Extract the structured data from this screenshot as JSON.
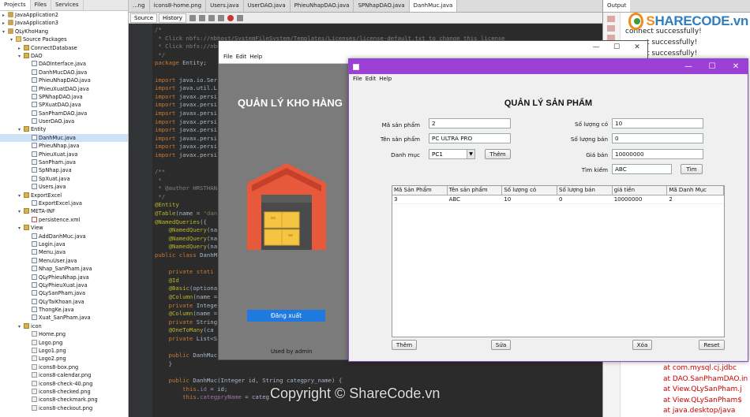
{
  "left_panel": {
    "tabs": [
      "Projects",
      "Files",
      "Services"
    ],
    "tree": [
      {
        "label": "JavaApplication2",
        "level": 0,
        "icon": "project-icon",
        "toggle": "+"
      },
      {
        "label": "JavaApplication3",
        "level": 0,
        "icon": "project-icon",
        "toggle": "+"
      },
      {
        "label": "QLyKhoHang",
        "level": 0,
        "icon": "project-icon",
        "toggle": "-"
      },
      {
        "label": "Source Packages",
        "level": 1,
        "icon": "folder-icon",
        "toggle": "-"
      },
      {
        "label": "ConnectDatabase",
        "level": 2,
        "icon": "package-icon",
        "toggle": "+"
      },
      {
        "label": "DAO",
        "level": 2,
        "icon": "package-icon",
        "toggle": "-"
      },
      {
        "label": "DAOInterface.java",
        "level": 3,
        "icon": "java-file-icon"
      },
      {
        "label": "DanhMucDAO.java",
        "level": 3,
        "icon": "java-file-icon"
      },
      {
        "label": "PhieuNhapDAO.java",
        "level": 3,
        "icon": "java-file-icon"
      },
      {
        "label": "PhieuXuatDAO.java",
        "level": 3,
        "icon": "java-file-icon"
      },
      {
        "label": "SPNhapDAO.java",
        "level": 3,
        "icon": "java-file-icon"
      },
      {
        "label": "SPXuatDAO.java",
        "level": 3,
        "icon": "java-file-icon"
      },
      {
        "label": "SanPhamDAO.java",
        "level": 3,
        "icon": "java-file-icon"
      },
      {
        "label": "UserDAO.java",
        "level": 3,
        "icon": "java-file-icon"
      },
      {
        "label": "Entity",
        "level": 2,
        "icon": "package-icon",
        "toggle": "-"
      },
      {
        "label": "DanhMuc.java",
        "level": 3,
        "icon": "java-file-icon",
        "selected": true
      },
      {
        "label": "PhieuNhap.java",
        "level": 3,
        "icon": "java-file-icon"
      },
      {
        "label": "PhieuXuat.java",
        "level": 3,
        "icon": "java-file-icon"
      },
      {
        "label": "SanPham.java",
        "level": 3,
        "icon": "java-file-icon"
      },
      {
        "label": "SpNhap.java",
        "level": 3,
        "icon": "java-file-icon"
      },
      {
        "label": "SpXuat.java",
        "level": 3,
        "icon": "java-file-icon"
      },
      {
        "label": "Users.java",
        "level": 3,
        "icon": "java-file-icon"
      },
      {
        "label": "ExportExcel",
        "level": 2,
        "icon": "package-icon",
        "toggle": "-"
      },
      {
        "label": "ExportExcel.java",
        "level": 3,
        "icon": "java-file-icon"
      },
      {
        "label": "META-INF",
        "level": 2,
        "icon": "package-icon",
        "toggle": "-"
      },
      {
        "label": "persistence.xml",
        "level": 3,
        "icon": "xml-file-icon"
      },
      {
        "label": "View",
        "level": 2,
        "icon": "package-icon",
        "toggle": "-"
      },
      {
        "label": "AddDanhMuc.java",
        "level": 3,
        "icon": "java-file-icon"
      },
      {
        "label": "Login.java",
        "level": 3,
        "icon": "java-file-icon"
      },
      {
        "label": "Menu.java",
        "level": 3,
        "icon": "java-file-icon"
      },
      {
        "label": "MenuUser.java",
        "level": 3,
        "icon": "java-file-icon"
      },
      {
        "label": "Nhap_SanPham.java",
        "level": 3,
        "icon": "java-file-icon"
      },
      {
        "label": "QLyPhieuNhap.java",
        "level": 3,
        "icon": "java-file-icon"
      },
      {
        "label": "QLyPhieuXuat.java",
        "level": 3,
        "icon": "java-file-icon"
      },
      {
        "label": "QLySanPham.java",
        "level": 3,
        "icon": "java-file-icon"
      },
      {
        "label": "QLyTaiKhoan.java",
        "level": 3,
        "icon": "java-file-icon"
      },
      {
        "label": "ThongKe.java",
        "level": 3,
        "icon": "java-file-icon"
      },
      {
        "label": "Xuat_SanPham.java",
        "level": 3,
        "icon": "java-file-icon"
      },
      {
        "label": "icon",
        "level": 2,
        "icon": "package-icon",
        "toggle": "-"
      },
      {
        "label": "Home.png",
        "level": 3,
        "icon": "image-file-icon"
      },
      {
        "label": "Logo.png",
        "level": 3,
        "icon": "image-file-icon"
      },
      {
        "label": "Logo1.png",
        "level": 3,
        "icon": "image-file-icon"
      },
      {
        "label": "Logo2.png",
        "level": 3,
        "icon": "image-file-icon"
      },
      {
        "label": "icons8-box.png",
        "level": 3,
        "icon": "image-file-icon"
      },
      {
        "label": "icons8-calendar.png",
        "level": 3,
        "icon": "image-file-icon"
      },
      {
        "label": "icons8-check-40.png",
        "level": 3,
        "icon": "image-file-icon"
      },
      {
        "label": "icons8-checked.png",
        "level": 3,
        "icon": "image-file-icon"
      },
      {
        "label": "icons8-checkmark.png",
        "level": 3,
        "icon": "image-file-icon"
      },
      {
        "label": "icons8-checkout.png",
        "level": 3,
        "icon": "image-file-icon"
      }
    ]
  },
  "editor": {
    "tabs": [
      "...ng",
      "icons8-home.png",
      "Users.java",
      "UserDAO.java",
      "PhieuNhapDAO.java",
      "SPNhapDAO.java",
      "DanhMuc.java"
    ],
    "active_tab": "DanhMuc.java",
    "toolbar": {
      "source": "Source",
      "history": "History"
    },
    "lines": [
      [
        [
          "cm",
          "/*"
        ]
      ],
      [
        [
          "cm",
          " * Click nbfs://nbhost/SystemFileSystem/Templates/Licenses/license-default.txt to change this license"
        ]
      ],
      [
        [
          "cm",
          " * Click nbfs://nbhost"
        ]
      ],
      [
        [
          "cm",
          " */"
        ]
      ],
      [
        [
          "kw",
          "package"
        ],
        [
          "",
          " Entity;"
        ]
      ],
      [
        [
          "",
          ""
        ]
      ],
      [
        [
          "kw",
          "import"
        ],
        [
          "",
          " java.io.Ser"
        ]
      ],
      [
        [
          "kw",
          "import"
        ],
        [
          "",
          " java.util.L"
        ]
      ],
      [
        [
          "kw",
          "import"
        ],
        [
          "",
          " javax.persi"
        ]
      ],
      [
        [
          "kw",
          "import"
        ],
        [
          "",
          " javax.persi"
        ]
      ],
      [
        [
          "kw",
          "import"
        ],
        [
          "",
          " javax.persi"
        ]
      ],
      [
        [
          "kw",
          "import"
        ],
        [
          "",
          " javax.persi"
        ]
      ],
      [
        [
          "kw",
          "import"
        ],
        [
          "",
          " javax.persi"
        ]
      ],
      [
        [
          "kw",
          "import"
        ],
        [
          "",
          " javax.persi"
        ]
      ],
      [
        [
          "kw",
          "import"
        ],
        [
          "",
          " javax.persi"
        ]
      ],
      [
        [
          "kw",
          "import"
        ],
        [
          "",
          " javax.persi"
        ]
      ],
      [
        [
          "",
          ""
        ]
      ],
      [
        [
          "cm",
          "/**"
        ]
      ],
      [
        [
          "cm",
          " *"
        ]
      ],
      [
        [
          "cm",
          " * @author HRSTHAN"
        ]
      ],
      [
        [
          "cm",
          " */"
        ]
      ],
      [
        [
          "an",
          "@Entity"
        ]
      ],
      [
        [
          "an",
          "@Table"
        ],
        [
          "",
          "(name = "
        ],
        [
          "str",
          "\"dan"
        ]
      ],
      [
        [
          "an",
          "@NamedQueries"
        ],
        [
          "",
          "({"
        ]
      ],
      [
        [
          "",
          "    "
        ],
        [
          "an",
          "@NamedQuery"
        ],
        [
          "",
          "(na"
        ]
      ],
      [
        [
          "",
          "    "
        ],
        [
          "an",
          "@NamedQuery"
        ],
        [
          "",
          "(na"
        ]
      ],
      [
        [
          "",
          "    "
        ],
        [
          "an",
          "@NamedQuery"
        ],
        [
          "",
          "(na"
        ]
      ],
      [
        [
          "kw",
          "public class"
        ],
        [
          "",
          " DanhM"
        ]
      ],
      [
        [
          "",
          ""
        ]
      ],
      [
        [
          "",
          "    "
        ],
        [
          "kw",
          "private stati"
        ]
      ],
      [
        [
          "",
          "    "
        ],
        [
          "an",
          "@Id"
        ]
      ],
      [
        [
          "",
          "    "
        ],
        [
          "an",
          "@Basic"
        ],
        [
          "",
          "(optiona"
        ]
      ],
      [
        [
          "",
          "    "
        ],
        [
          "an",
          "@Column"
        ],
        [
          "",
          "(name ="
        ]
      ],
      [
        [
          "",
          "    "
        ],
        [
          "kw",
          "private"
        ],
        [
          "",
          " Intege"
        ]
      ],
      [
        [
          "",
          "    "
        ],
        [
          "an",
          "@Column"
        ],
        [
          "",
          "(name ="
        ]
      ],
      [
        [
          "",
          "    "
        ],
        [
          "kw",
          "private"
        ],
        [
          "",
          " String"
        ]
      ],
      [
        [
          "",
          "    "
        ],
        [
          "an",
          "@OneToMany"
        ],
        [
          "",
          "(ca"
        ]
      ],
      [
        [
          "",
          "    "
        ],
        [
          "kw",
          "private"
        ],
        [
          "",
          " List<S"
        ]
      ],
      [
        [
          "",
          ""
        ]
      ],
      [
        [
          "",
          "    "
        ],
        [
          "kw",
          "public"
        ],
        [
          "",
          " DanhMuc"
        ]
      ],
      [
        [
          "",
          "    }"
        ]
      ],
      [
        [
          "",
          ""
        ]
      ],
      [
        [
          "",
          "    "
        ],
        [
          "kw",
          "public"
        ],
        [
          "",
          " DanhMuc(Integer id, String categpry_name) {"
        ]
      ],
      [
        [
          "",
          "        "
        ],
        [
          "kw",
          "this"
        ],
        [
          "",
          "."
        ],
        [
          "fld",
          "id"
        ],
        [
          "",
          " = id;"
        ]
      ],
      [
        [
          "",
          "        "
        ],
        [
          "kw",
          "this"
        ],
        [
          "",
          "."
        ],
        [
          "fld",
          "categpryName"
        ],
        [
          "",
          " = categ"
        ]
      ]
    ]
  },
  "output": {
    "tab": "Output",
    "lines": [
      {
        "text": "connect successfully!",
        "error": false
      },
      {
        "text": "ct successfully!",
        "error": false
      },
      {
        "text": "ct successfully!",
        "error": false
      }
    ],
    "error_lines": [
      "at com.mysql.cj.jdbc",
      "at DAO.SanPhamDAO.in",
      "at View.QLySanPham.j",
      "at View.QLySanPham$",
      "at java.desktop/java"
    ]
  },
  "watermark": {
    "logo": "SHARECODE.vn",
    "copyright": "Copyright © ShareCode.vn",
    "center": "ShareCode.vn"
  },
  "menu_window": {
    "menu": [
      "File",
      "Edit",
      "Help"
    ],
    "heading": "QUẢN LÝ KHO HÀNG",
    "logout_button": "Đăng xuất",
    "used_by": "Used by  admin"
  },
  "product_window": {
    "menu": [
      "File",
      "Edit",
      "Help"
    ],
    "title": "QUẢN LÝ SẢN PHẨM",
    "fields": {
      "ma_label": "Mã sản phẩm",
      "ma_value": "2",
      "ten_label": "Tên sản phẩm",
      "ten_value": "PC ULTRA PRO",
      "danhmuc_label": "Danh mục",
      "danhmuc_value": "PC1",
      "soluongco_label": "Số lượng có",
      "soluongco_value": "10",
      "soluongban_label": "Số lượng bán",
      "soluongban_value": "0",
      "giaban_label": "Giá bán",
      "giaban_value": "10000000",
      "timkiem_label": "Tìm kiếm",
      "timkiem_value": "ABC"
    },
    "add_category_button": "Thêm",
    "search_button": "Tìm",
    "table": {
      "headers": [
        "Mã Sản Phẩm",
        "Tên sản phẩm",
        "Số lượng có",
        "Số lượng bán",
        "giá tiền",
        "Mã Danh Mục"
      ],
      "rows": [
        [
          "3",
          "ABC",
          "10",
          "0",
          "10000000",
          "2"
        ]
      ]
    },
    "buttons": {
      "add": "Thêm",
      "edit": "Sửa",
      "delete": "Xóa",
      "reset": "Reset"
    }
  }
}
